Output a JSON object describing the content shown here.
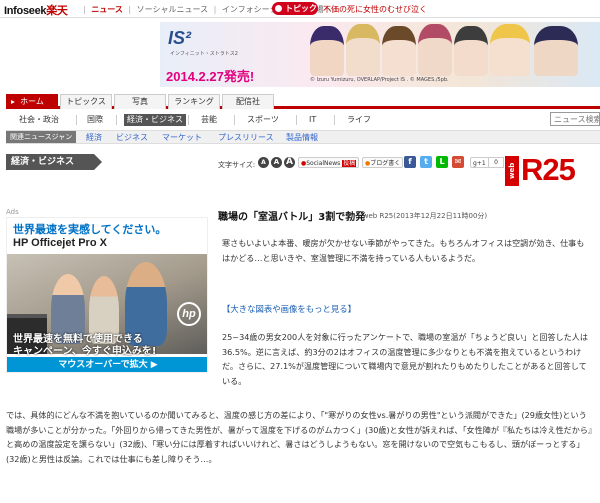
{
  "topbar": {
    "logo_a": "Infoseek",
    "logo_b": "楽天",
    "current": "ニュース",
    "links": [
      "ソーシャルニュース",
      "インフォシーク",
      "楽天市場へ"
    ],
    "topics_badge": "トピックス",
    "topics_text": "不価の死に女性のむせび泣く"
  },
  "banner": {
    "title": "IS²",
    "subtitle": "インフィニット・ストラトス2",
    "date": "2014.2.27発売!",
    "copyright": "© Izuru Yumizuru, OVERLAP/Project IS . © MAGES./5pb."
  },
  "mainnav": [
    "ホーム",
    "トピックス",
    "写真",
    "ランキング",
    "配信社"
  ],
  "subnav": [
    "社会・政治",
    "国際",
    "経済・ビジネス",
    "芸能",
    "スポーツ",
    "IT",
    "ライフ"
  ],
  "search": {
    "placeholder": "ニュース検索"
  },
  "genre": {
    "label": "関連ニュースジャンル",
    "items": [
      "経済",
      "ビジネス",
      "マーケット",
      "プレスリリース",
      "製品情報"
    ]
  },
  "section_title": "経済・ビジネス",
  "toolbar": {
    "font_size_label": "文字サイズ:",
    "a": "A",
    "socialnews": "SocialNews",
    "post": "投稿",
    "blog": "ブログ",
    "blog_suffix": "書く",
    "gplus": "g+1",
    "gplus_count": "0"
  },
  "brand": {
    "web": "web",
    "r25": "R25"
  },
  "ads": {
    "label": "Ads",
    "headline1": "世界最速を実感してください。",
    "headline2": "HP Officejet Pro X",
    "hp": "hp",
    "cta1": "世界最速を無料で使用できる",
    "cta2": "キャンペーン、今すぐ申込みを!",
    "bar": "マウスオーバーで拡大 ▶"
  },
  "article": {
    "title": "職場の「室温バトル」3割で勃発",
    "meta": "- web R25(2013年12月22日11時00分)",
    "p1": "寒さもいよいよ本番、暖房が欠かせない季節がやってきた。もちろんオフィスは空調が効き、仕事もはかどる…と思いきや、室温管理に不満を持っている人もいるようだ。",
    "more": "【大きな図表や画像をもっと見る】",
    "p2": "25~34歳の男女200人を対象に行ったアンケートで、職場の室温が「ちょうど良い」と回答した人は36.5%。逆に言えば、約3分の2はオフィスの温度管理に多少なりとも不満を抱えているというわけだ。さらに、27.1%が温度管理について職場内で意見が割れたりもめたりしたことがあると回答している。",
    "p3": "では、具体的にどんな不満を抱いているのか聞いてみると、温度の感じ方の差により、「\"寒がりの女性vs.暑がりの男性\"という派閥ができた」(29歳女性)という職場が多いことが分かった。「外回りから帰ってきた男性が、暑がって温度を下げるのがムカつく」(30歳)と女性が訴えれば、「女性陣が『私たちは冷え性だから』と高めの温度設定を譲らない」(32歳)、「寒い分には厚着すればいいけれど、暑さはどうしようもない。窓を開けないので空気もこもるし、頭がぼーっとする」(32歳)と男性は反論。これでは仕事にも差し障りそう…。"
  }
}
